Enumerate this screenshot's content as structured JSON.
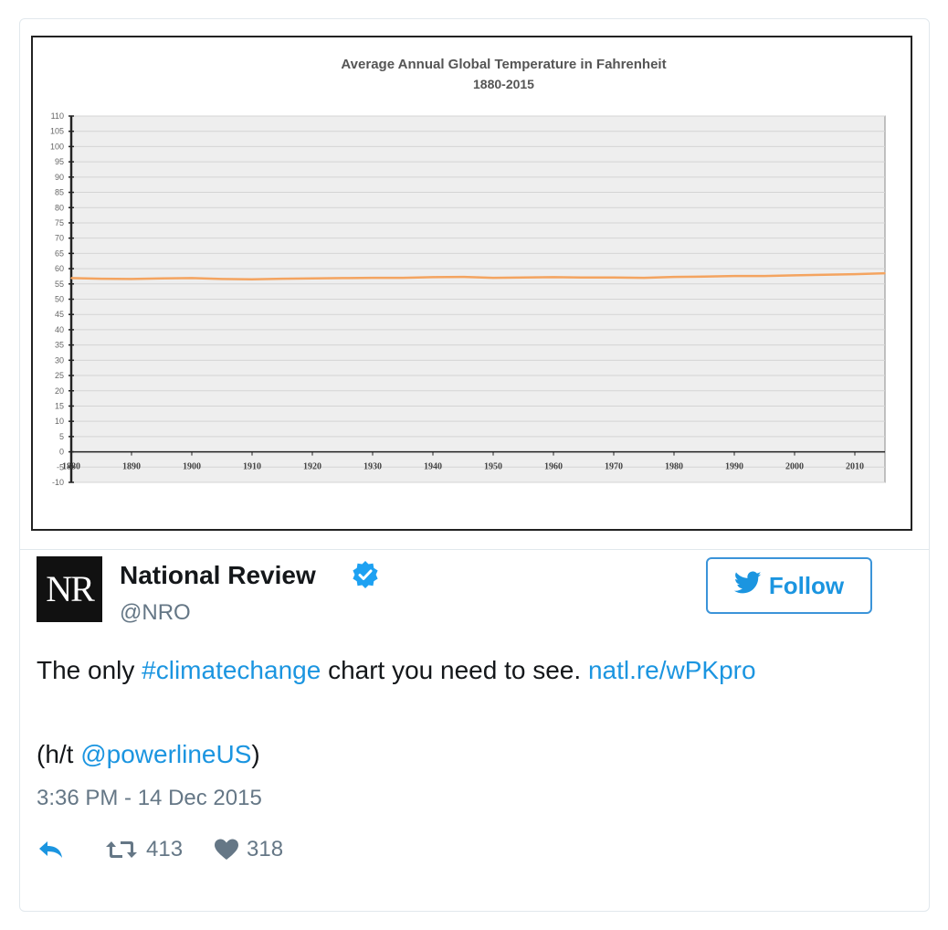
{
  "chart_data": {
    "type": "line",
    "title": "Average Annual Global Temperature in Fahrenheit",
    "subtitle": "1880-2015",
    "xlabel": "",
    "ylabel": "",
    "xlim": [
      1880,
      2015
    ],
    "ylim": [
      -10,
      110
    ],
    "x_ticks": [
      1880,
      1890,
      1900,
      1910,
      1920,
      1930,
      1940,
      1950,
      1960,
      1970,
      1980,
      1990,
      2000,
      2010
    ],
    "x_tick_labels": [
      "1880",
      "1890",
      "1900",
      "1910",
      "1920",
      "1930",
      "1940",
      "1950",
      "1960",
      "1970",
      "1980",
      "1990",
      "2000",
      "2010"
    ],
    "y_ticks": [
      -10,
      -5,
      0,
      5,
      10,
      15,
      20,
      25,
      30,
      35,
      40,
      45,
      50,
      55,
      60,
      65,
      70,
      75,
      80,
      85,
      90,
      95,
      100,
      105,
      110
    ],
    "grid": true,
    "line_color": "#f4a460",
    "series": [
      {
        "x": [
          1880,
          1885,
          1890,
          1895,
          1900,
          1905,
          1910,
          1915,
          1920,
          1925,
          1930,
          1935,
          1940,
          1945,
          1950,
          1955,
          1960,
          1965,
          1970,
          1975,
          1980,
          1985,
          1990,
          1995,
          2000,
          2005,
          2010,
          2015
        ],
        "values": [
          56.9,
          56.7,
          56.6,
          56.8,
          56.9,
          56.6,
          56.5,
          56.7,
          56.8,
          56.9,
          57.0,
          57.0,
          57.2,
          57.3,
          57.0,
          57.1,
          57.2,
          57.1,
          57.1,
          57.0,
          57.3,
          57.4,
          57.6,
          57.6,
          57.8,
          58.0,
          58.2,
          58.5
        ]
      }
    ]
  },
  "tweet": {
    "avatar_text": "NR",
    "name": "National Review",
    "handle": "@NRO",
    "follow_label": "Follow",
    "text_before": "The only ",
    "hashtag": "#climatechange",
    "text_middle": " chart you need to see. ",
    "link": "natl.re/wPKpro",
    "ht_open": "(h/t ",
    "ht_mention": "@powerlineUS",
    "ht_close": ")",
    "timestamp": "3:36 PM - 14 Dec 2015",
    "retweet_count": "413",
    "like_count": "318"
  },
  "colors": {
    "accent": "#1b95e0",
    "muted": "#657786",
    "verified": "#1da1f2"
  }
}
